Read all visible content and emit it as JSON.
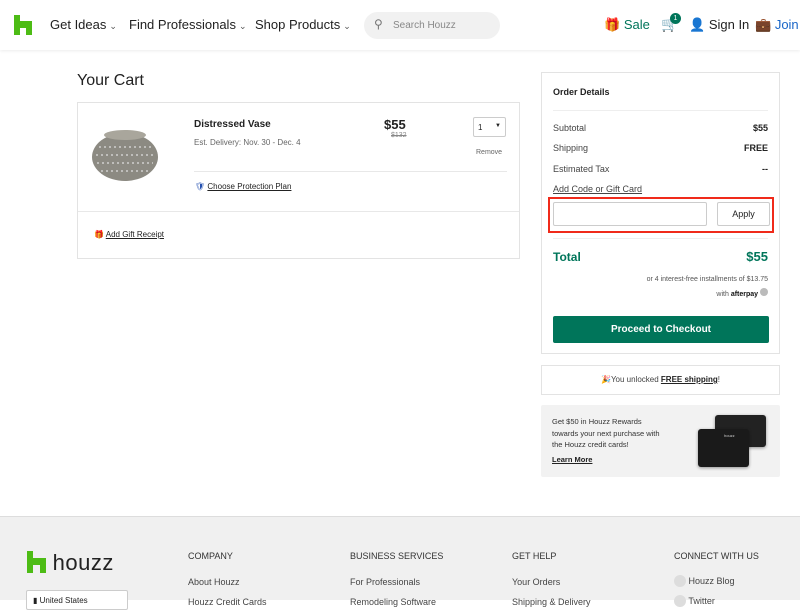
{
  "header": {
    "nav": [
      {
        "label": "Get Ideas"
      },
      {
        "label": "Find Professionals"
      },
      {
        "label": "Shop Products"
      }
    ],
    "search_placeholder": "Search Houzz",
    "sale": "Sale",
    "cart_count": "1",
    "sign_in": "Sign In",
    "join": "Join a",
    "brand_color": "#4dbc15",
    "accent": "#00755a"
  },
  "cart": {
    "title": "Your Cart",
    "item": {
      "name": "Distressed Vase",
      "delivery": "Est. Delivery: Nov. 30 - Dec. 4",
      "price": "$55",
      "original_price": "$132",
      "quantity": "1",
      "remove": "Remove",
      "protection": "Choose Protection Plan"
    },
    "gift_receipt": "Add Gift Receipt"
  },
  "order": {
    "title": "Order Details",
    "rows": [
      {
        "label": "Subtotal",
        "value": "$55"
      },
      {
        "label": "Shipping",
        "value": "FREE"
      },
      {
        "label": "Estimated Tax",
        "value": "--"
      }
    ],
    "code_link": "Add Code or Gift Card",
    "code_value": "",
    "apply": "Apply",
    "total_label": "Total",
    "total": "$55",
    "installments": "or 4 interest-free installments of $13.75",
    "with": "with",
    "afterpay": "afterpay",
    "checkout": "Proceed to Checkout"
  },
  "shipping_banner": {
    "prefix": "You unlocked ",
    "link": "FREE shipping",
    "suffix": "!"
  },
  "rewards": {
    "text": "Get $50 in Houzz Rewards towards your next purchase with the Houzz credit cards!",
    "link": "Learn More",
    "card_brand": "houzz"
  },
  "footer": {
    "logo": "houzz",
    "country": "United States",
    "columns": [
      {
        "title": "COMPANY",
        "links": [
          "About Houzz",
          "Houzz Credit Cards"
        ]
      },
      {
        "title": "BUSINESS SERVICES",
        "links": [
          "For Professionals",
          "Remodeling Software"
        ]
      },
      {
        "title": "GET HELP",
        "links": [
          "Your Orders",
          "Shipping & Delivery"
        ]
      },
      {
        "title": "CONNECT WITH US",
        "links": [
          "Houzz Blog",
          "Twitter"
        ]
      }
    ]
  }
}
